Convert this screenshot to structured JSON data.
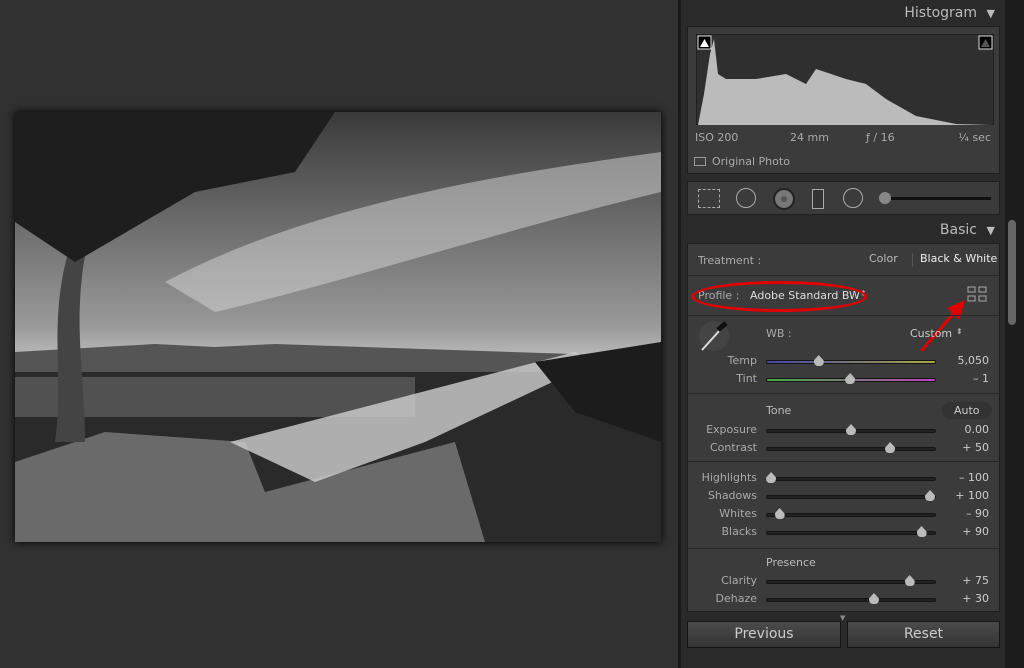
{
  "histogram": {
    "title": "Histogram",
    "iso": "ISO 200",
    "focal": "24 mm",
    "aperture": "ƒ / 16",
    "shutter": "¼ sec",
    "original_photo": "Original Photo"
  },
  "tools": [
    "crop-overlay",
    "spot-removal",
    "red-eye",
    "graduated-filter",
    "radial-filter",
    "adjustment-brush"
  ],
  "basic": {
    "title": "Basic",
    "treatment_label": "Treatment :",
    "treatment_color": "Color",
    "treatment_bw": "Black & White",
    "profile_label": "Profile :",
    "profile_value": "Adobe Standard BW",
    "wb_label": "WB :",
    "wb_value": "Custom",
    "tone_label": "Tone",
    "auto_label": "Auto",
    "presence_label": "Presence",
    "sliders": [
      {
        "name": "Temp",
        "value": "5,050",
        "pos": 0.31
      },
      {
        "name": "Tint",
        "value": "– 1",
        "pos": 0.495
      },
      {
        "name": "Exposure",
        "value": "0.00",
        "pos": 0.5
      },
      {
        "name": "Contrast",
        "value": "+ 50",
        "pos": 0.73
      },
      {
        "name": "Highlights",
        "value": "– 100",
        "pos": 0.03
      },
      {
        "name": "Shadows",
        "value": "+ 100",
        "pos": 0.965
      },
      {
        "name": "Whites",
        "value": "– 90",
        "pos": 0.08
      },
      {
        "name": "Blacks",
        "value": "+ 90",
        "pos": 0.915
      },
      {
        "name": "Clarity",
        "value": "+ 75",
        "pos": 0.845
      },
      {
        "name": "Dehaze",
        "value": "+ 30",
        "pos": 0.635
      }
    ]
  },
  "buttons": {
    "previous": "Previous",
    "reset": "Reset"
  },
  "annotation_color": "#e00000"
}
